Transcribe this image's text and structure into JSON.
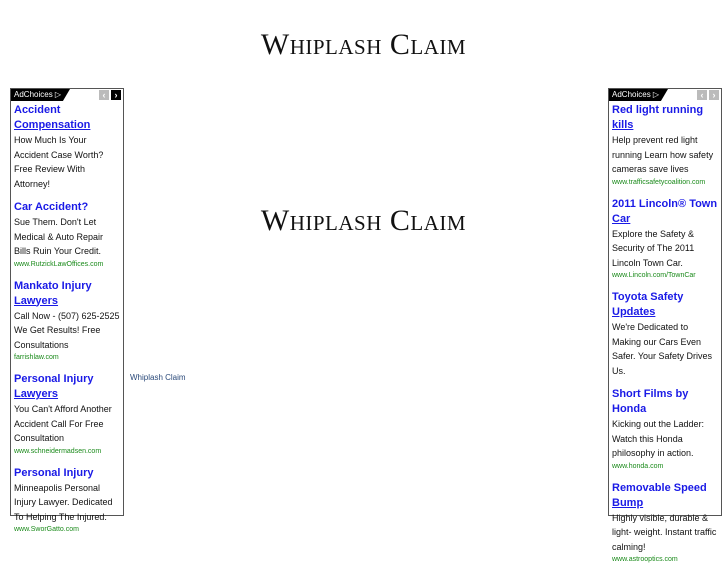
{
  "page": {
    "title": "Whiplash Claim",
    "center_title": "Whiplash Claim",
    "side_link": "Whiplash Claim"
  },
  "ads_left": {
    "adchoices_label": "AdChoices ▷",
    "prev_icon": "‹",
    "next_icon": "›",
    "items": [
      {
        "title_line1": "Accident",
        "title_line2": "Compensation",
        "desc": "How Much Is Your Accident Case Worth? Free Review With Attorney!",
        "url": ""
      },
      {
        "title_line1": "Car Accident?",
        "title_line2": "",
        "desc": "Sue Them. Don't Let Medical & Auto Repair Bills Ruin Your Credit.",
        "url": "www.RutzickLawOffices.com"
      },
      {
        "title_line1": "Mankato Injury",
        "title_line2": "Lawyers",
        "desc": "Call Now - (507) 625-2525 We Get Results! Free Consultations",
        "url": "farrishlaw.com"
      },
      {
        "title_line1": "Personal Injury",
        "title_line2": "Lawyers",
        "desc": "You Can't Afford Another Accident Call For Free Consultation",
        "url": "www.schneidermadsen.com"
      },
      {
        "title_line1": "Personal Injury",
        "title_line2": "",
        "desc": "Minneapolis Personal Injury Lawyer. Dedicated To Helping The Injured.",
        "url": "www.SworGatto.com"
      }
    ]
  },
  "ads_right": {
    "adchoices_label": "AdChoices ▷",
    "prev_icon": "‹",
    "next_icon": "›",
    "items": [
      {
        "title_line1": "Red light running",
        "title_line2": "kills",
        "desc": "Help prevent red light running Learn how safety cameras save lives",
        "url": "www.trafficsafetycoalition.com"
      },
      {
        "title_line1": "2011 Lincoln® Town",
        "title_line2": "Car",
        "desc": "Explore the Safety & Security of The 2011 Lincoln Town Car.",
        "url": "www.Lincoln.com/TownCar"
      },
      {
        "title_line1": "Toyota Safety",
        "title_line2": "Updates",
        "desc": "We're Dedicated to Making our Cars Even Safer. Your Safety Drives Us.",
        "url": ""
      },
      {
        "title_line1": "Short Films by Honda",
        "title_line2": "",
        "desc": "Kicking out the Ladder: Watch this Honda philosophy in action.",
        "url": "www.honda.com"
      },
      {
        "title_line1": "Removable Speed",
        "title_line2": "Bump",
        "desc": "Highly visible, durable & light- weight. Instant traffic calming!",
        "url": "www.astrooptics.com"
      }
    ]
  }
}
